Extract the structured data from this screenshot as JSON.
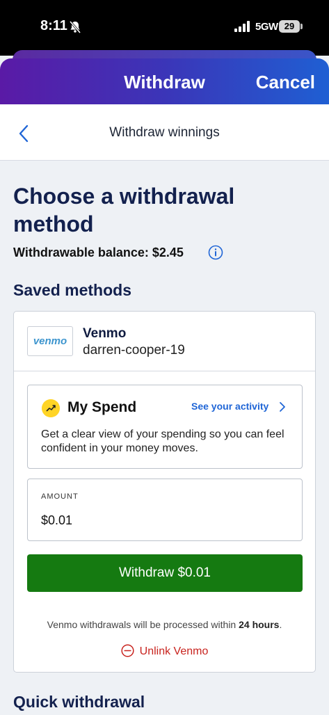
{
  "status_bar": {
    "time": "8:11",
    "network": "5GW",
    "battery": "29"
  },
  "header": {
    "title": "Withdraw",
    "cancel_label": "Cancel"
  },
  "subnav": {
    "title": "Withdraw winnings"
  },
  "page": {
    "title": "Choose a withdrawal method",
    "balance_label": "Withdrawable balance: $2.45"
  },
  "saved_methods": {
    "title": "Saved methods",
    "venmo": {
      "logo_text": "venmo",
      "name": "Venmo",
      "handle": "darren-cooper-19"
    },
    "my_spend": {
      "title": "My Spend",
      "link": "See your activity",
      "description": "Get a clear view of your spending so you can feel confident in your money moves."
    },
    "amount": {
      "label": "AMOUNT",
      "value": "$0.01"
    },
    "withdraw_button": "Withdraw $0.01",
    "notice_prefix": "Venmo withdrawals will be processed within ",
    "notice_bold": "24 hours",
    "notice_suffix": ".",
    "unlink_label": "Unlink Venmo"
  },
  "quick_withdrawal": {
    "title": "Quick withdrawal"
  },
  "colors": {
    "header_gradient_start": "#5a1aa6",
    "header_gradient_end": "#1f5fd3",
    "withdraw_button": "#157a11",
    "link_blue": "#1f65d6",
    "unlink_red": "#c8231e",
    "venmo_blue": "#3d95ce"
  }
}
